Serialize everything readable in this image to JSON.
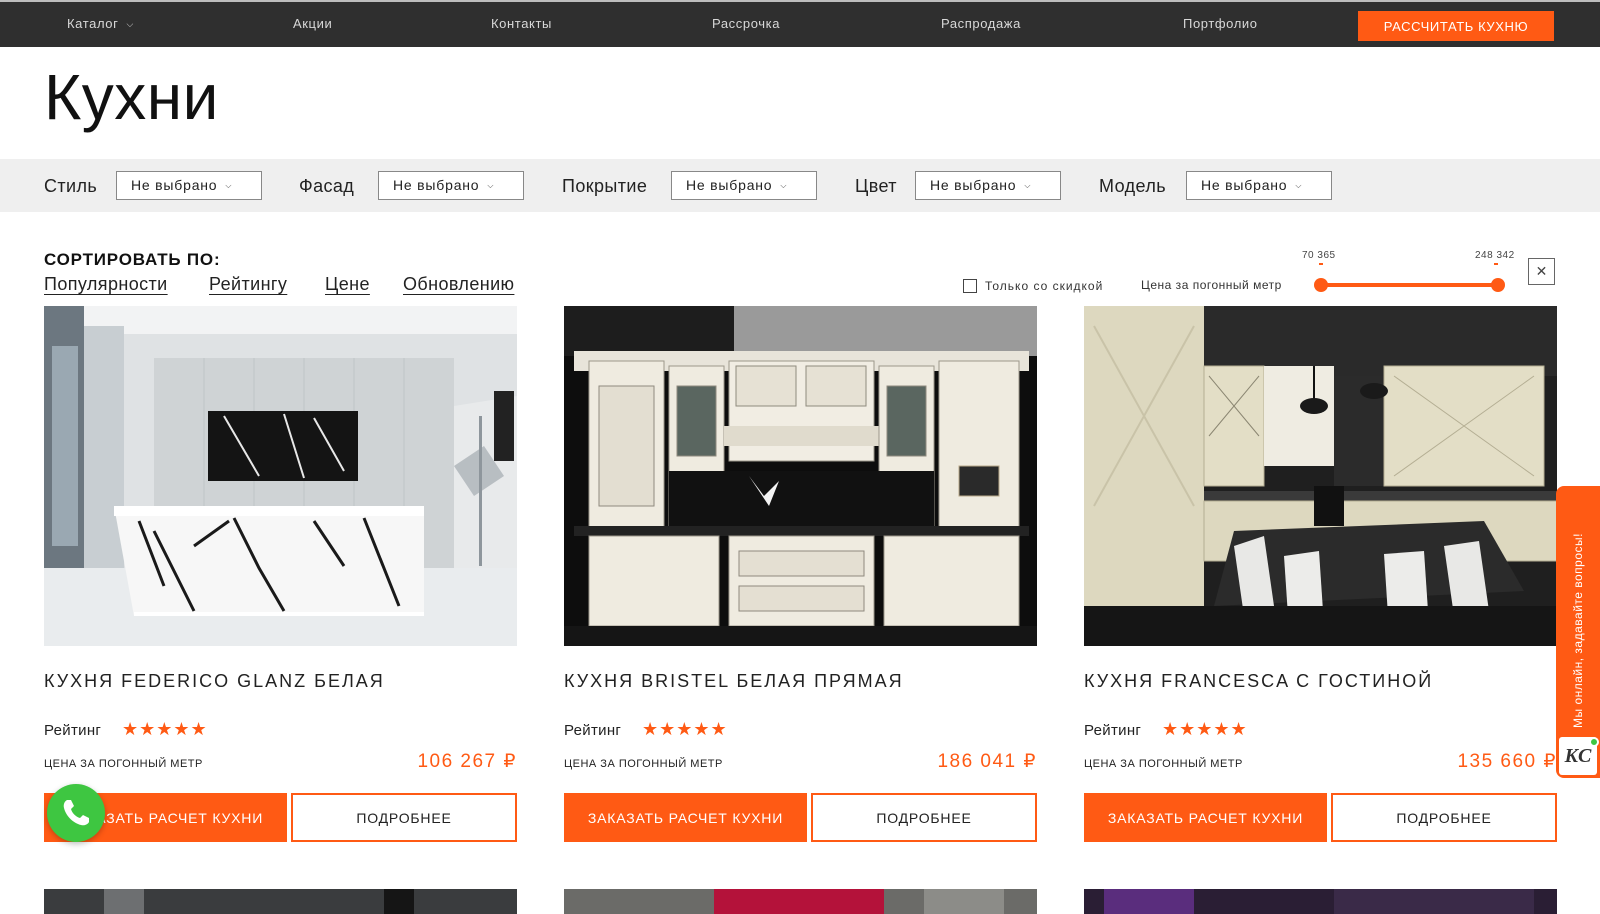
{
  "nav": {
    "items": [
      {
        "label": "Каталог",
        "has_dropdown": true
      },
      {
        "label": "Акции"
      },
      {
        "label": "Контакты"
      },
      {
        "label": "Рассрочка"
      },
      {
        "label": "Распродажа"
      },
      {
        "label": "Портфолио"
      }
    ],
    "cta_label": "РАССЧИТАТЬ КУХНЮ"
  },
  "page": {
    "title": "Кухни"
  },
  "filters": {
    "style": {
      "label": "Стиль",
      "value": "Не выбрано"
    },
    "facade": {
      "label": "Фасад",
      "value": "Не выбрано"
    },
    "coating": {
      "label": "Покрытие",
      "value": "Не выбрано"
    },
    "color": {
      "label": "Цвет",
      "value": "Не выбрано"
    },
    "model": {
      "label": "Модель",
      "value": "Не выбрано"
    }
  },
  "sort": {
    "title": "СОРТИРОВАТЬ ПО:",
    "options": [
      "Популярности",
      "Рейтингу",
      "Цене",
      "Обновлению"
    ]
  },
  "price_filter": {
    "discount_only_label": "Только со скидкой",
    "discount_only_checked": false,
    "label": "Цена за погонный метр",
    "min": "70 365",
    "max": "248 342",
    "selected_min_fraction": 0.0,
    "selected_max_fraction": 1.0
  },
  "products": [
    {
      "name": "КУХНЯ FEDERICO GLANZ БЕЛАЯ",
      "rating_label": "Рейтинг",
      "rating": 5,
      "stars": "★★★★★",
      "price_caption": "ЦЕНА ЗА ПОГОННЫЙ МЕТР",
      "price": "106 267 ₽",
      "order_label": "ЗАКАЗАТЬ РАСЧЕТ КУХНИ",
      "more_label": "ПОДРОБНЕЕ"
    },
    {
      "name": "КУХНЯ BRISTEL БЕЛАЯ ПРЯМАЯ",
      "rating_label": "Рейтинг",
      "rating": 5,
      "stars": "★★★★★",
      "price_caption": "ЦЕНА ЗА ПОГОННЫЙ МЕТР",
      "price": "186 041 ₽",
      "order_label": "ЗАКАЗАТЬ РАСЧЕТ КУХНИ",
      "more_label": "ПОДРОБНЕЕ"
    },
    {
      "name": "КУХНЯ FRANCESCA С ГОСТИНОЙ",
      "rating_label": "Рейтинг",
      "rating": 5,
      "stars": "★★★★★",
      "price_caption": "ЦЕНА ЗА ПОГОННЫЙ МЕТР",
      "price": "135 660 ₽",
      "order_label": "ЗАКАЗАТЬ РАСЧЕТ КУХНИ",
      "more_label": "ПОДРОБНЕЕ"
    }
  ],
  "chat": {
    "label": "Мы онлайн, задавайте вопросы!",
    "logo": "KC"
  },
  "icons": {
    "phone": "phone-icon",
    "close": "close-icon",
    "chevron": "chevron-down-icon",
    "star": "star-icon"
  },
  "colors": {
    "accent": "#ff5a14",
    "nav_bg": "#2f2f2f",
    "filter_bg": "#efefef",
    "phone_green": "#3ec641"
  }
}
